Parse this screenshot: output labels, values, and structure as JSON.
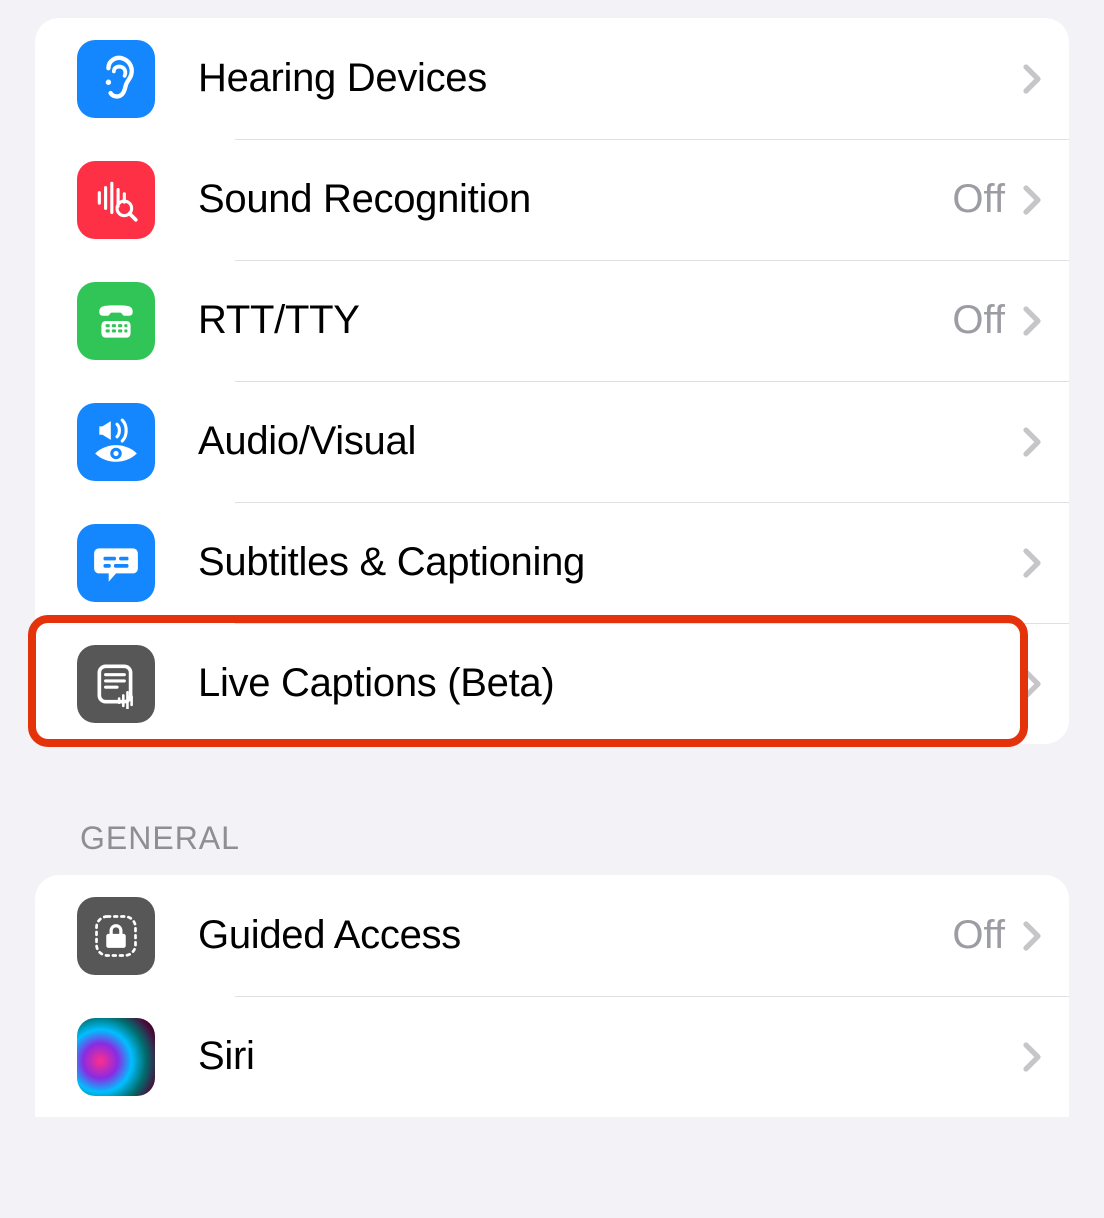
{
  "sections": {
    "hearing": {
      "items": [
        {
          "label": "Hearing Devices",
          "value": "",
          "icon": "hearing-devices-icon",
          "bg": "#1487ff"
        },
        {
          "label": "Sound Recognition",
          "value": "Off",
          "icon": "sound-recognition-icon",
          "bg": "#fd3046"
        },
        {
          "label": "RTT/TTY",
          "value": "Off",
          "icon": "rtt-tty-icon",
          "bg": "#31c558"
        },
        {
          "label": "Audio/Visual",
          "value": "",
          "icon": "audio-visual-icon",
          "bg": "#1487ff"
        },
        {
          "label": "Subtitles & Captioning",
          "value": "",
          "icon": "subtitles-icon",
          "bg": "#1487ff"
        },
        {
          "label": "Live Captions (Beta)",
          "value": "",
          "icon": "live-captions-icon",
          "bg": "#575757"
        }
      ]
    },
    "general": {
      "header": "GENERAL",
      "items": [
        {
          "label": "Guided Access",
          "value": "Off",
          "icon": "guided-access-icon",
          "bg": "#575757"
        },
        {
          "label": "Siri",
          "value": "",
          "icon": "siri-icon",
          "bg": "siri"
        }
      ]
    }
  }
}
